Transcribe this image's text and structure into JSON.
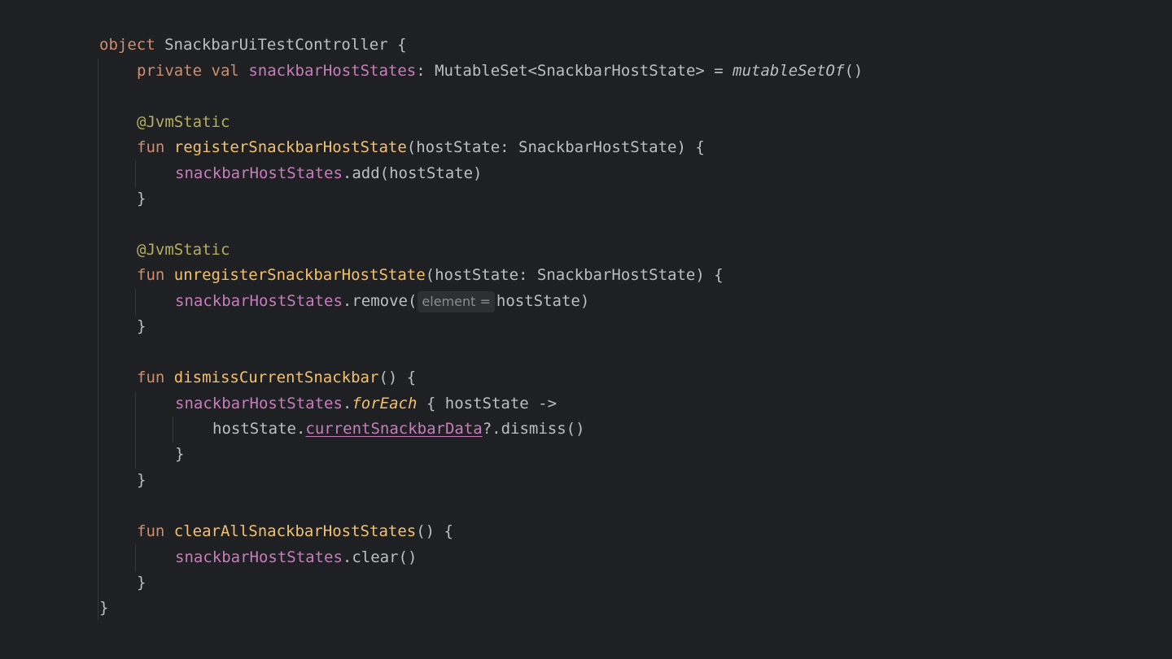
{
  "code": {
    "object_kw": "object",
    "object_name": "SnackbarUiTestController",
    "open_brace": "{",
    "close_brace": "}",
    "private_kw": "private",
    "val_kw": "val",
    "set_prop": "snackbarHostStates",
    "set_type": ": MutableSet<SnackbarHostState> = ",
    "set_init": "mutableSetOf",
    "parens": "()",
    "annotation": "@JvmStatic",
    "fun_kw": "fun",
    "register_name": "registerSnackbarHostState",
    "register_params": "(hostState: SnackbarHostState) {",
    "add_call": ".add(hostState)",
    "unregister_name": "unregisterSnackbarHostState",
    "unregister_params": "(hostState: SnackbarHostState) {",
    "remove_call_open": ".remove(",
    "param_hint": "element =",
    "remove_call_close": "hostState)",
    "dismiss_name": "dismissCurrentSnackbar",
    "dismiss_params": "() {",
    "foreach_dot": ".",
    "foreach_name": "forEach",
    "foreach_lambda": " { hostState ->",
    "host_state_dot": "hostState.",
    "current_data": "currentSnackbarData",
    "dismiss_call": "?.dismiss()",
    "clear_all_name": "clearAllSnackbarHostStates",
    "clear_all_params": "() {",
    "clear_call": ".clear()"
  }
}
